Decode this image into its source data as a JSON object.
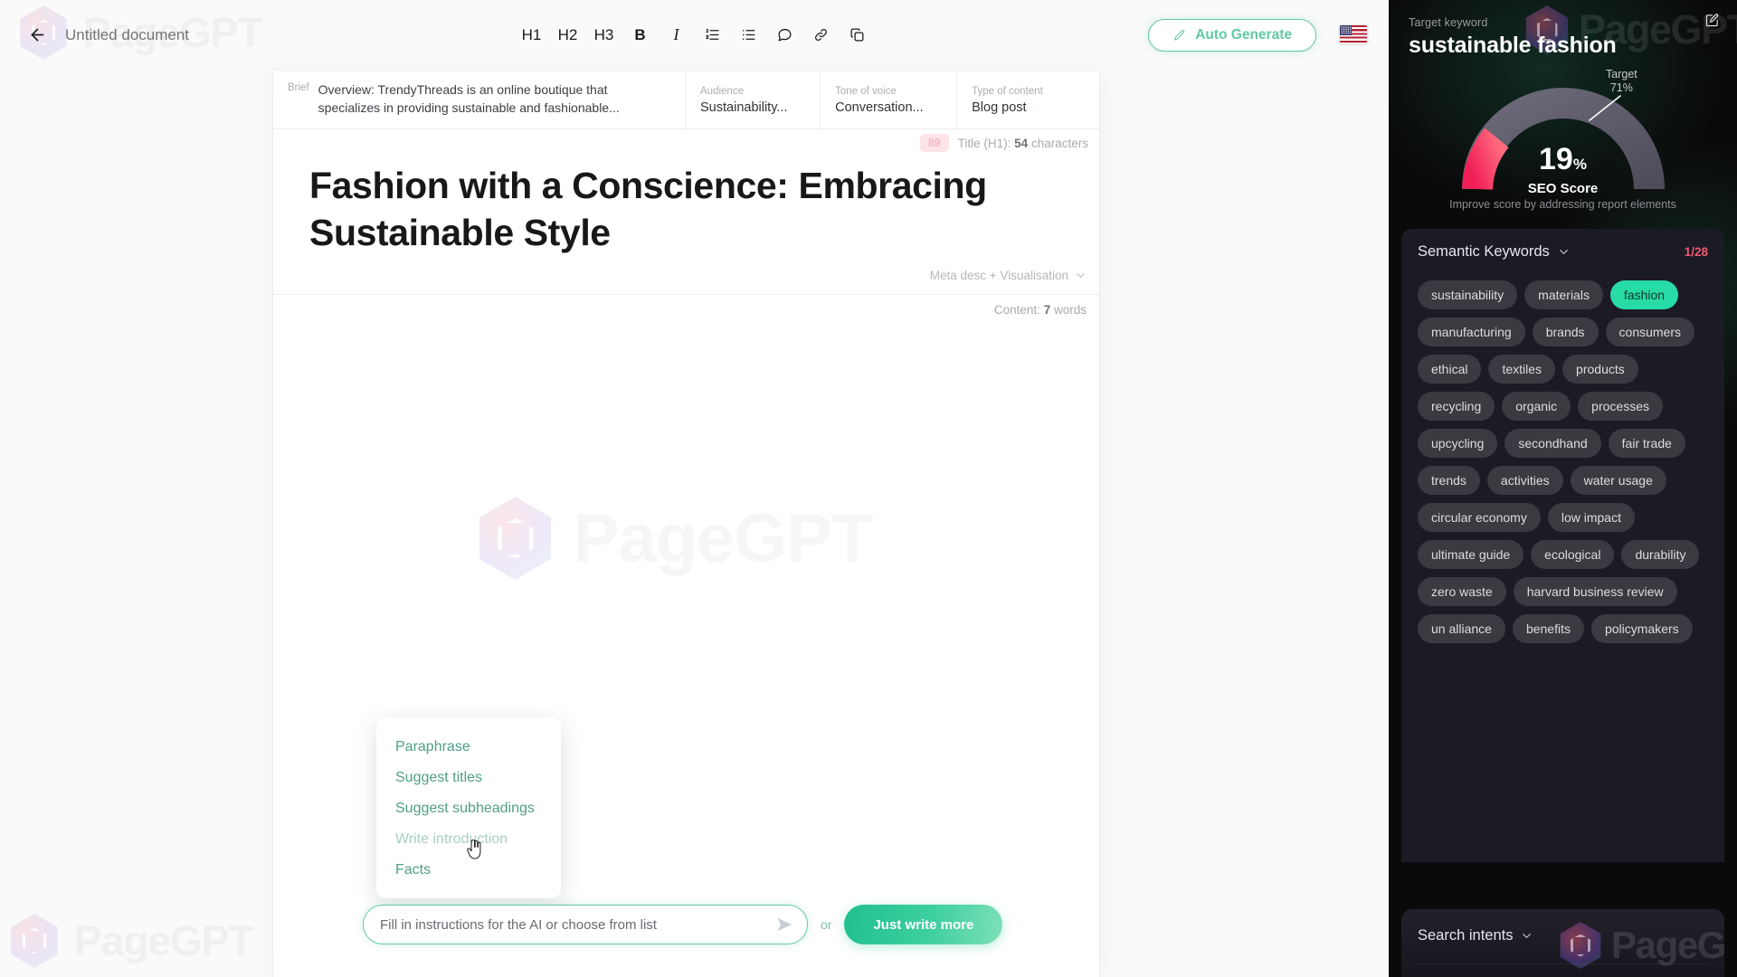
{
  "topbar": {
    "back_icon": "arrow-left-icon",
    "document_title_value": "Untitled document",
    "document_title_placeholder": "Untitled document",
    "tools": [
      {
        "name": "h1",
        "label": "H1"
      },
      {
        "name": "h2",
        "label": "H2"
      },
      {
        "name": "h3",
        "label": "H3"
      },
      {
        "name": "bold",
        "label": "B"
      },
      {
        "name": "italic",
        "label": "I"
      },
      {
        "name": "ordered-list",
        "label": "ordered-list-icon"
      },
      {
        "name": "bullet-list",
        "label": "bullet-list-icon"
      },
      {
        "name": "comment",
        "label": "comment-icon"
      },
      {
        "name": "link",
        "label": "link-icon"
      },
      {
        "name": "copy",
        "label": "copy-icon"
      }
    ],
    "auto_generate_label": "Auto Generate",
    "auto_generate_icon": "pencil-icon",
    "language_flag": "us-flag"
  },
  "brief": {
    "label": "Brief",
    "overview_text": "Overview: TrendyThreads is an online boutique that specializes in providing sustainable and fashionable...",
    "fields": [
      {
        "label": "Audience",
        "value": "Sustainability..."
      },
      {
        "label": "Tone of voice",
        "value": "Conversation..."
      },
      {
        "label": "Type of content",
        "value": "Blog post"
      }
    ]
  },
  "document": {
    "title_score": "89",
    "title_meta_prefix": "Title (H1):",
    "title_meta_count": "54",
    "title_meta_suffix": "characters",
    "h1": "Fashion with a Conscience: Embracing Sustainable Style",
    "meta_desc_label": "Meta desc + Visualisation",
    "content_prefix": "Content:",
    "content_count": "7",
    "content_suffix": "words",
    "watermark": "PageGPT"
  },
  "ai_menu": {
    "items": [
      {
        "label": "Paraphrase",
        "muted": false
      },
      {
        "label": "Suggest titles",
        "muted": false
      },
      {
        "label": "Suggest subheadings",
        "muted": false
      },
      {
        "label": "Write introduction",
        "muted": true
      },
      {
        "label": "Facts",
        "muted": false
      }
    ]
  },
  "prompt": {
    "placeholder": "Fill in instructions for the AI or choose from list",
    "value": "",
    "send_icon": "send-icon",
    "or_label": "or",
    "just_write_label": "Just write more"
  },
  "sidebar": {
    "target_keyword_label": "Target keyword",
    "target_keyword": "sustainable fashion",
    "edit_icon": "edit-icon",
    "gauge": {
      "score": "19",
      "score_unit": "%",
      "score_label": "SEO Score",
      "target_label": "Target",
      "target_value": "71%",
      "hint": "Improve score by addressing report elements",
      "score_color": "#f4365e",
      "track_color": "#5a5666"
    },
    "semantic_keywords": {
      "title": "Semantic Keywords",
      "count": "1/28",
      "chips": [
        {
          "label": "sustainability",
          "active": false
        },
        {
          "label": "materials",
          "active": false
        },
        {
          "label": "fashion",
          "active": true
        },
        {
          "label": "manufacturing",
          "active": false
        },
        {
          "label": "brands",
          "active": false
        },
        {
          "label": "consumers",
          "active": false
        },
        {
          "label": "ethical",
          "active": false
        },
        {
          "label": "textiles",
          "active": false
        },
        {
          "label": "products",
          "active": false
        },
        {
          "label": "recycling",
          "active": false
        },
        {
          "label": "organic",
          "active": false
        },
        {
          "label": "processes",
          "active": false
        },
        {
          "label": "upcycling",
          "active": false
        },
        {
          "label": "secondhand",
          "active": false
        },
        {
          "label": "fair trade",
          "active": false
        },
        {
          "label": "trends",
          "active": false
        },
        {
          "label": "activities",
          "active": false
        },
        {
          "label": "water usage",
          "active": false
        },
        {
          "label": "circular economy",
          "active": false
        },
        {
          "label": "low impact",
          "active": false
        },
        {
          "label": "ultimate guide",
          "active": false
        },
        {
          "label": "ecological",
          "active": false
        },
        {
          "label": "durability",
          "active": false
        },
        {
          "label": "zero waste",
          "active": false
        },
        {
          "label": "harvard business review",
          "active": false
        },
        {
          "label": "un alliance",
          "active": false
        },
        {
          "label": "benefits",
          "active": false
        },
        {
          "label": "policymakers",
          "active": false
        }
      ]
    },
    "search_intents": {
      "title": "Search intents"
    },
    "watermark": "PageGPT"
  }
}
